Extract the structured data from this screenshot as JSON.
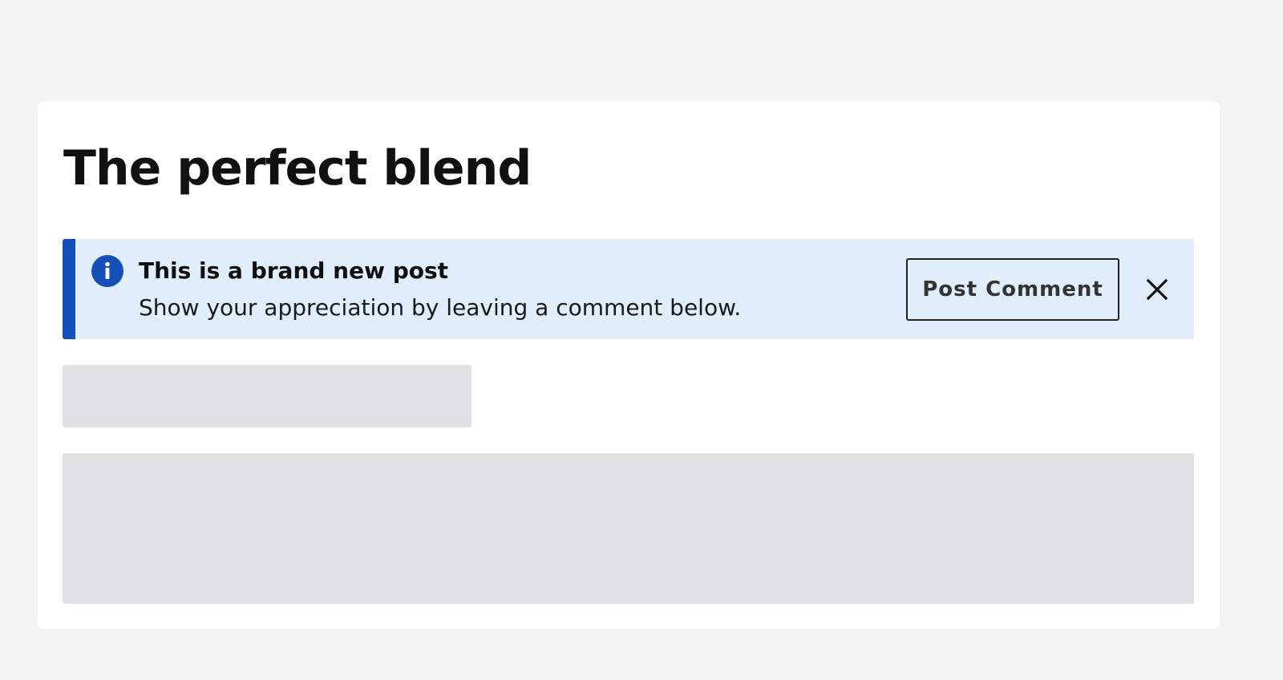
{
  "page": {
    "title": "The perfect blend"
  },
  "notice": {
    "icon": "info-icon",
    "heading": "This is a brand new post",
    "message": "Show your appreciation by leaving a comment below.",
    "action_label": "Post Comment",
    "close_icon": "close-icon"
  },
  "colors": {
    "page_background": "#f3f3f3",
    "card_background": "#ffffff",
    "notice_background": "#e0edfa",
    "notice_accent": "#1550b8",
    "placeholder": "#e0e1e3"
  }
}
